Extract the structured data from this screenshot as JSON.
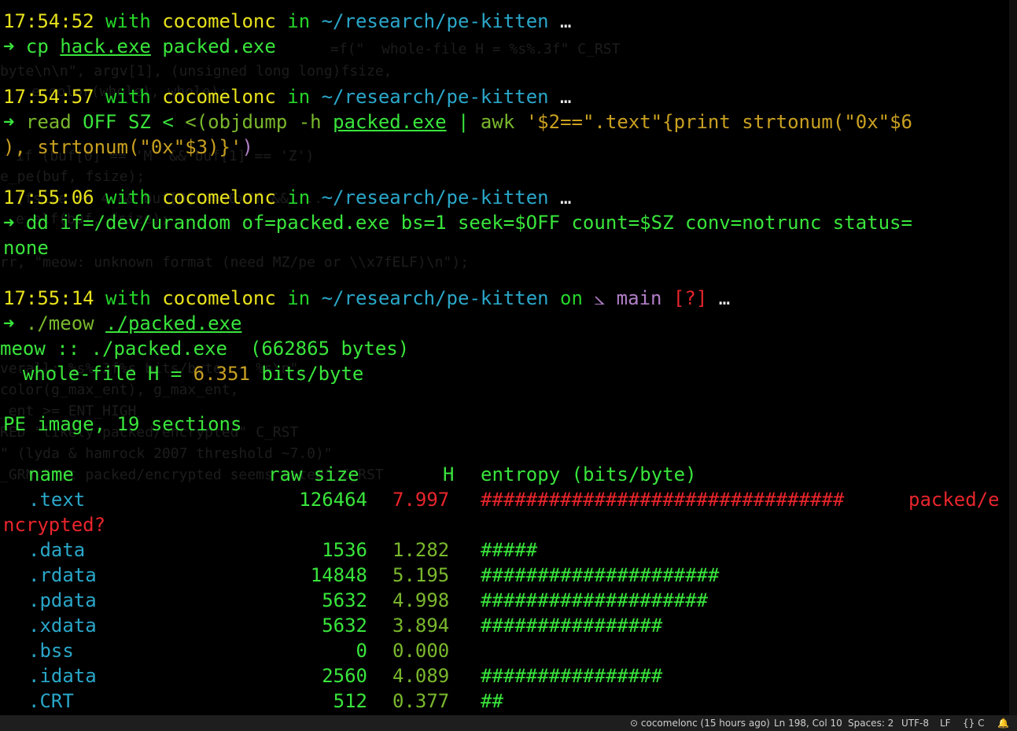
{
  "prompts": [
    {
      "time": "17:54:52",
      "with": "with",
      "user": "cocomelonc",
      "in": "in",
      "path": "~/research/pe-kitten",
      "tail": "…"
    },
    {
      "time": "17:54:57",
      "with": "with",
      "user": "cocomelonc",
      "in": "in",
      "path": "~/research/pe-kitten",
      "tail": "…"
    },
    {
      "time": "17:55:06",
      "with": "with",
      "user": "cocomelonc",
      "in": "in",
      "path": "~/research/pe-kitten",
      "tail": "…"
    },
    {
      "time": "17:55:14",
      "with": "with",
      "user": "cocomelonc",
      "in": "in",
      "path": "~/research/pe-kitten",
      "on": "on",
      "branch_icon": "⦣",
      "branch": "main",
      "status": "[?]",
      "tail": "…"
    }
  ],
  "arrow": "➜",
  "cmd1": {
    "cmd": "cp",
    "arg1": "hack.exe",
    "arg2": "packed.exe"
  },
  "cmd2": {
    "line1_a": "read",
    "line1_b": "OFF SZ",
    "line1_c": "<",
    "line1_d": "<(objdump -h",
    "line1_e": "packed.exe",
    "line1_f": "|",
    "line1_g": "awk",
    "line1_h": "'$2==\".text\"{print strtonum(\"0x\"$6",
    "line2": "), strtonum(\"0x\"$3)}'",
    "line2_close": ")"
  },
  "cmd3": {
    "line1": "dd if=/dev/urandom of=packed.exe bs=1 seek=$OFF count=$SZ conv=notrunc status=",
    "line2": "none"
  },
  "cmd4": {
    "prog": "./meow",
    "arg": "./packed.exe"
  },
  "output": {
    "header": "meow :: ./packed.exe  (662865 bytes)",
    "whole_prefix": "  whole-file H = ",
    "whole_value": "6.351",
    "whole_suffix": " bits/byte",
    "pe_line": "PE image, 19 sections",
    "col_name": "name",
    "col_size": "raw size",
    "col_h": "H",
    "col_entropy": "entropy (bits/byte)",
    "warn_tail": "packed/e",
    "warn_wrap": "ncrypted?"
  },
  "sections": [
    {
      "name": ".text",
      "size": "126464",
      "h": "7.997",
      "bar": "################################",
      "hot": true
    },
    {
      "name": ".data",
      "size": "1536",
      "h": "1.282",
      "bar": "#####",
      "hot": false
    },
    {
      "name": ".rdata",
      "size": "14848",
      "h": "5.195",
      "bar": "#####################",
      "hot": false
    },
    {
      "name": ".pdata",
      "size": "5632",
      "h": "4.998",
      "bar": "####################",
      "hot": false
    },
    {
      "name": ".xdata",
      "size": "5632",
      "h": "3.894",
      "bar": "################",
      "hot": false
    },
    {
      "name": ".bss",
      "size": "0",
      "h": "0.000",
      "bar": "",
      "hot": false
    },
    {
      "name": ".idata",
      "size": "2560",
      "h": "4.089",
      "bar": "################",
      "hot": false
    },
    {
      "name": ".CRT",
      "size": "512",
      "h": "0.377",
      "bar": "##",
      "hot": false
    }
  ],
  "ghost_text": [
    "=f(\"  whole-file H = %s%.3f\" C_RST",
    "byte\\n\\n\", argv[1], (unsigned long long)fsize,",
    "e_color(whole), whole);",
    "if (buf[0] == 'M' && buf[1] == 'Z')",
    "e_pe(buf, fsize);",
    "(fsize >= 4 && buf[0] == 0x7f && ...",
    "e_elf(buf, fsize);",
    "rr, \"meow: unknown format (need MZ/pe or \\\\x7fELF)\\n\");",
    "verall: %s%.3f%s bits/byte  ~ %s\\n\",",
    "color(g_max_ent), g_max_ent,",
    "_ent >= ENT_HIGH",
    "RED \"likely packed/encrypted\" C_RST",
    "\" (lyda & hamrock 2007 threshold ~7.0)\"",
    "_GRN \"not packed/encrypted seems rated\" C_RST"
  ],
  "statusbar": {
    "git": "cocomelonc (15 hours ago)",
    "position": "Ln 198, Col 10",
    "spaces": "Spaces: 2",
    "encoding": "UTF-8",
    "eol": "LF",
    "lang": "{} C",
    "bell": "🔔"
  }
}
